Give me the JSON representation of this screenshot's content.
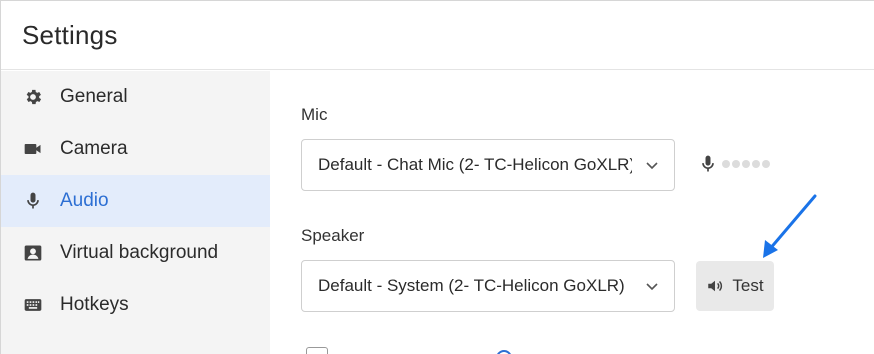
{
  "window": {
    "title": "Settings"
  },
  "sidebar": {
    "items": [
      {
        "label": "General",
        "icon": "gear-icon",
        "active": false
      },
      {
        "label": "Camera",
        "icon": "camera-icon",
        "active": false
      },
      {
        "label": "Audio",
        "icon": "microphone-icon",
        "active": true
      },
      {
        "label": "Virtual background",
        "icon": "portrait-icon",
        "active": false
      },
      {
        "label": "Hotkeys",
        "icon": "keyboard-icon",
        "active": false
      }
    ]
  },
  "audio": {
    "mic": {
      "label": "Mic",
      "selected": "Default - Chat Mic (2- TC-Helicon GoXLR)",
      "level_icon": "microphone-icon"
    },
    "speaker": {
      "label": "Speaker",
      "selected": "Default - System (2- TC-Helicon GoXLR)",
      "test_label": "Test",
      "test_icon": "speaker-icon"
    }
  },
  "colors": {
    "accent": "#2d6fd3",
    "active_bg": "#e3ecfb",
    "sidebar_bg": "#f4f4f4",
    "annotation_arrow": "#1a73e8"
  }
}
